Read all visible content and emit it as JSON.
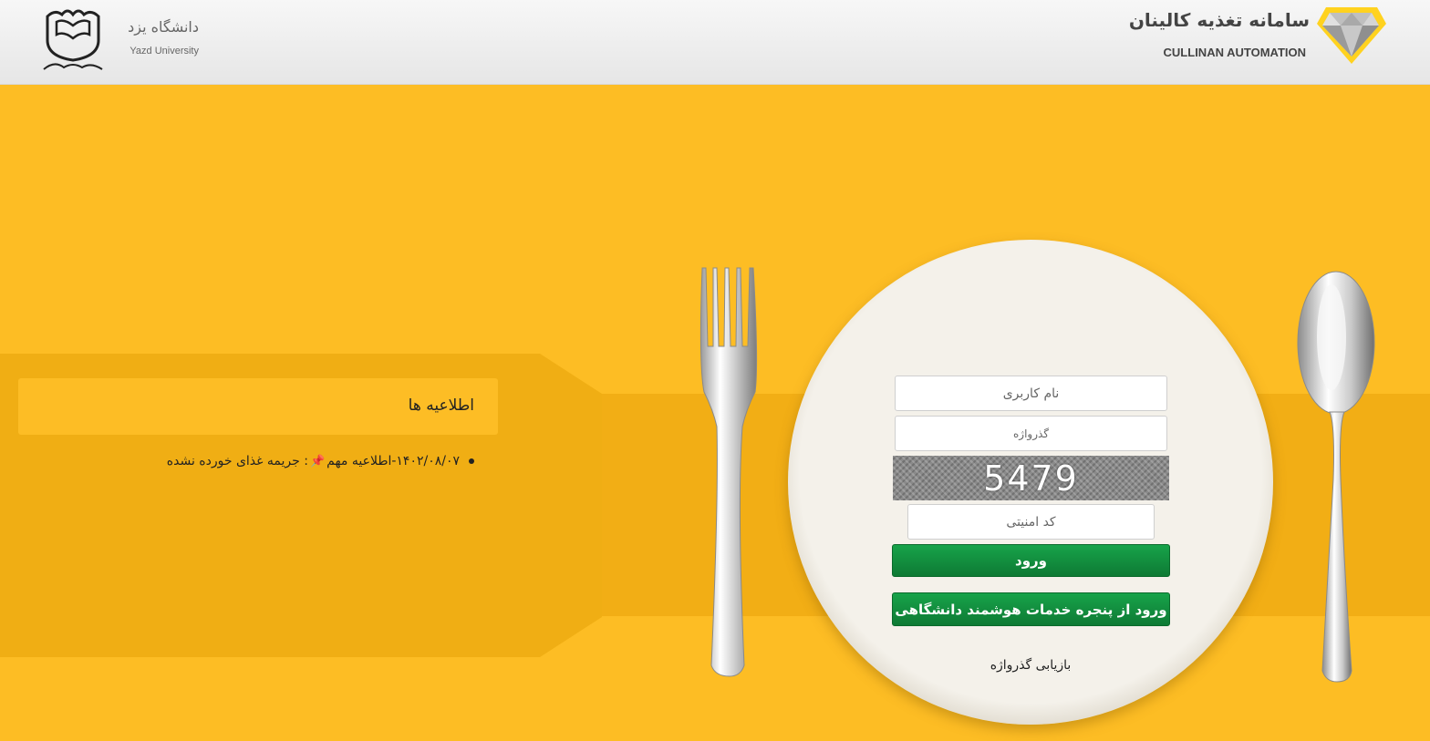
{
  "header": {
    "university_name": "دانشگاه یزد",
    "university_name_en": "Yazd University",
    "system_title": "سامانه تغذیه کالینان",
    "system_title_en": "CULLINAN AUTOMATION"
  },
  "news": {
    "title": "اطلاعیه ها",
    "items": [
      {
        "prefix": "۱۴۰۲/۰۸/۰۷-اطلاعیه مهم",
        "text": ": جریمه غذای خورده نشده"
      }
    ]
  },
  "login": {
    "username_placeholder": "نام کاربری",
    "password_placeholder": "گذرواژه",
    "captcha_code": "5479",
    "captcha_placeholder": "کد امنیتی",
    "login_button": "ورود",
    "sso_button": "ورود از پنجره خدمات هوشمند دانشگاهی",
    "recover_link": "بازیابی گذرواژه"
  },
  "colors": {
    "background": "#fdbd24",
    "band": "#f2ae15",
    "button_green": "#11893d"
  }
}
